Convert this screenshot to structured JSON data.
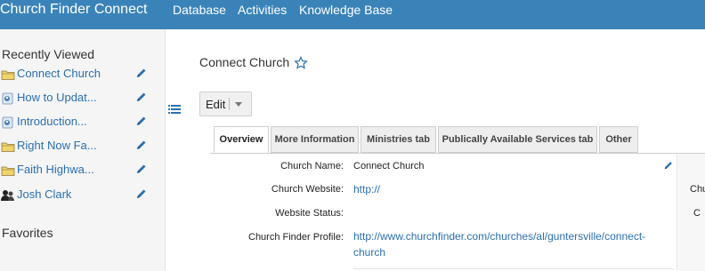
{
  "app": {
    "title": "Church Finder Connect"
  },
  "nav": {
    "items": [
      {
        "label": "Database"
      },
      {
        "label": "Activities"
      },
      {
        "label": "Knowledge Base"
      }
    ]
  },
  "sidebar": {
    "recent_heading": "Recently Viewed",
    "recent_items": [
      {
        "label": "Connect Church",
        "icon": "folder-icon"
      },
      {
        "label": "How to Updat...",
        "icon": "knowledge-article-icon"
      },
      {
        "label": "Introduction...",
        "icon": "knowledge-article-icon"
      },
      {
        "label": "Right Now Fa...",
        "icon": "folder-icon"
      },
      {
        "label": "Faith Highwa...",
        "icon": "folder-icon"
      },
      {
        "label": "Josh Clark",
        "icon": "contact-icon"
      }
    ],
    "favorites_heading": "Favorites"
  },
  "record": {
    "title": "Connect Church",
    "edit_label": "Edit"
  },
  "tabs": [
    {
      "label": "Overview",
      "active": true
    },
    {
      "label": "More Information",
      "active": false
    },
    {
      "label": "Ministries tab",
      "active": false
    },
    {
      "label": "Publically Available Services tab",
      "active": false
    },
    {
      "label": "Other",
      "active": false
    }
  ],
  "fields": [
    {
      "label": "Church Name:",
      "value": "Connect Church"
    },
    {
      "label": "Church Website:",
      "value": "http://"
    },
    {
      "label": "Website Status:",
      "value": ""
    },
    {
      "label": "Church Finder Profile:",
      "value_line1": "http://www.churchfinder.com/churches/al/guntersville/connect-",
      "value_line2": "church"
    }
  ],
  "right_column_labels": [
    "Chu",
    "C"
  ],
  "colors": {
    "header": "#3a83b8",
    "link": "#2a6fb0",
    "sidebar_bg": "#f5f5f5"
  }
}
